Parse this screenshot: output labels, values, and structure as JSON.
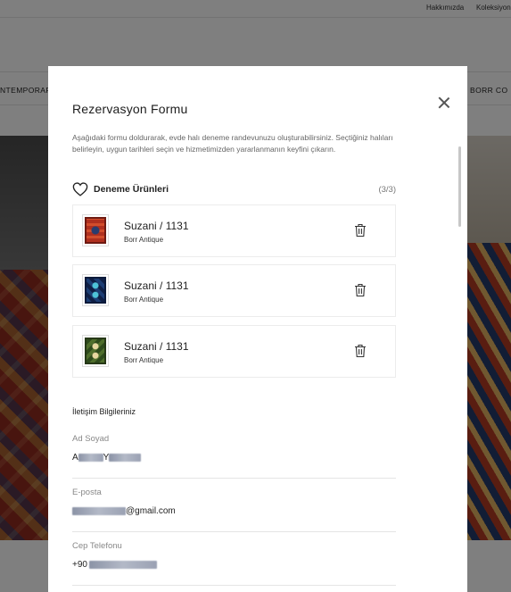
{
  "background": {
    "top_links": [
      "Hakkımızda",
      "Koleksiyonl"
    ],
    "nav_left": "NTEMPORAR",
    "nav_right": "BORR CO"
  },
  "modal": {
    "title": "Rezervasyon Formu",
    "description": "Aşağıdaki formu doldurarak, evde halı deneme randevunuzu oluşturabilirsiniz. Seçtiğiniz halıları belirleyin, uygun tarihleri seçin ve hizmetimizden yararlanmanın keyfini çıkarın.",
    "section": {
      "title": "Deneme Ürünleri",
      "count": "(3/3)",
      "icon": "heart-icon"
    },
    "products": [
      {
        "name": "Suzani / 1131",
        "brand": "Borr Antique"
      },
      {
        "name": "Suzani / 1131",
        "brand": "Borr Antique"
      },
      {
        "name": "Suzani / 1131",
        "brand": "Borr Antique"
      }
    ],
    "contact": {
      "title": "İletişim Bilgileriniz",
      "fields": [
        {
          "label": "Ad Soyad",
          "value_prefix": "A",
          "value_middle": "Y",
          "value_suffix": ""
        },
        {
          "label": "E-posta",
          "value_prefix": "",
          "value_middle": "",
          "value_suffix": "@gmail.com"
        },
        {
          "label": "Cep Telefonu",
          "value_prefix": "+90",
          "value_middle": "",
          "value_suffix": ""
        }
      ]
    }
  }
}
